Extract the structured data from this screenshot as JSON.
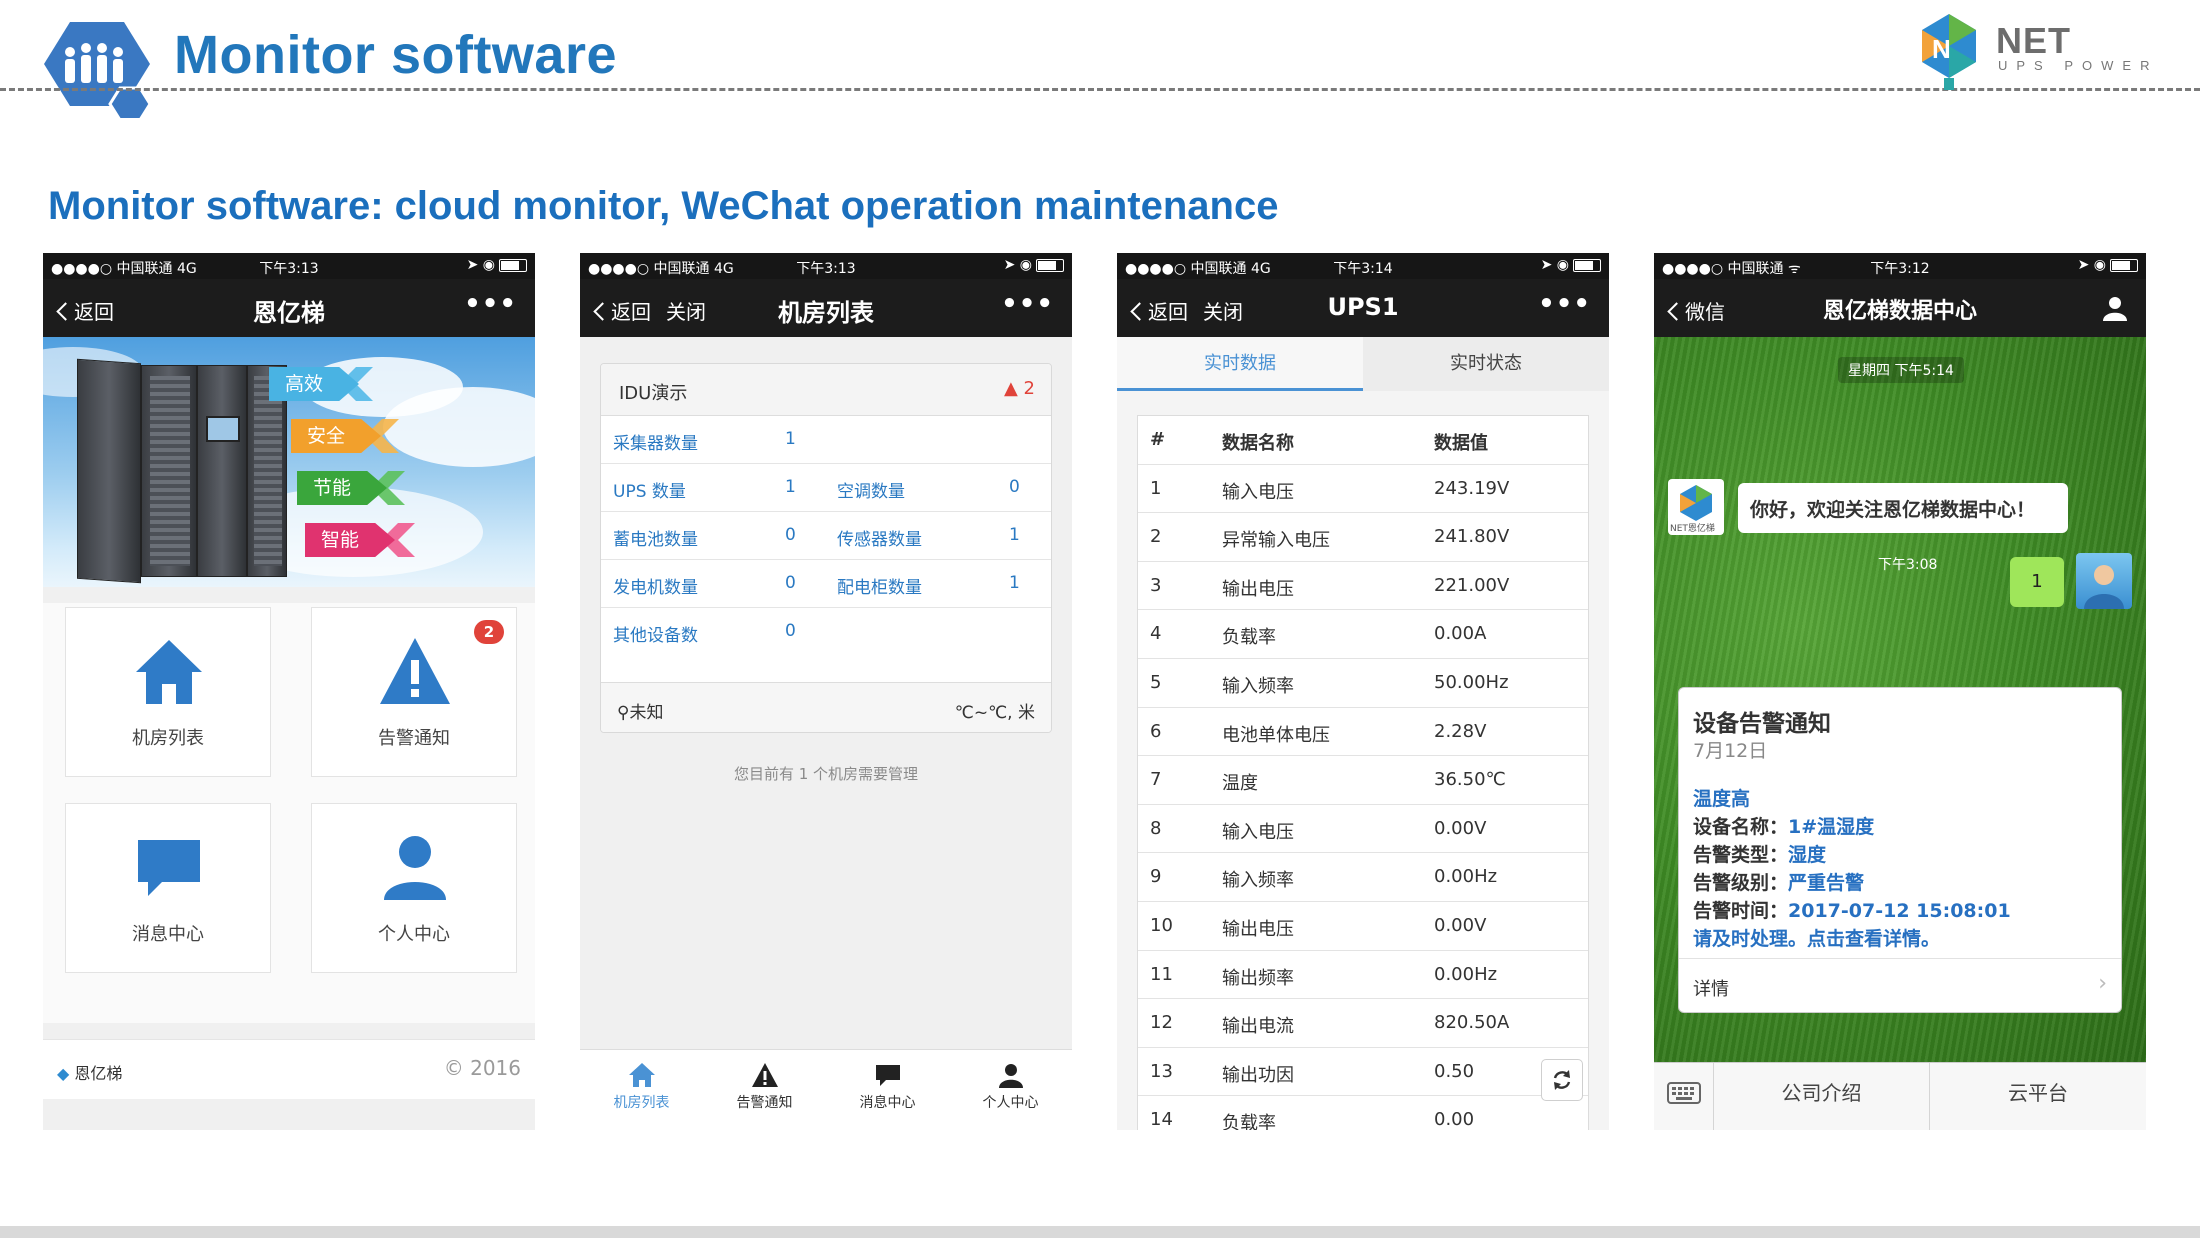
{
  "slide": {
    "title": "Monitor software",
    "subtitle": "Monitor software: cloud monitor, WeChat operation maintenance",
    "brand_name": "NET",
    "brand_sub": "UPS POWER",
    "colors": {
      "title": "#2277bb",
      "accent": "#1b6fbd"
    }
  },
  "status_bars": [
    {
      "carrier": "●●●●○ 中国联通  4G",
      "time": "下午3:13"
    },
    {
      "carrier": "●●●●○ 中国联通  4G",
      "time": "下午3:13"
    },
    {
      "carrier": "●●●●○ 中国联通  4G",
      "time": "下午3:14"
    },
    {
      "carrier": "●●●●○ 中国联通 ᯤ",
      "time": "下午3:12"
    }
  ],
  "phone1": {
    "back": "返回",
    "title": "恩亿梯",
    "more": "•••",
    "tags": [
      "高效",
      "安全",
      "节能",
      "智能"
    ],
    "tiles": [
      {
        "label": "机房列表",
        "icon": "home-icon"
      },
      {
        "label": "告警通知",
        "icon": "warning-icon",
        "badge": "2"
      },
      {
        "label": "消息中心",
        "icon": "chat-bubble-icon"
      },
      {
        "label": "个人中心",
        "icon": "user-icon"
      }
    ],
    "footer_logo": "恩亿梯",
    "copyright": "© 2016"
  },
  "phone2": {
    "back": "返回",
    "close": "关闭",
    "title": "机房列表",
    "more": "•••",
    "card_name": "IDU演示",
    "alarm_count": "2",
    "rows": [
      {
        "l1": "采集器数量",
        "v1": "1",
        "l2": "",
        "v2": ""
      },
      {
        "l1": "UPS 数量",
        "v1": "1",
        "l2": "空调数量",
        "v2": "0"
      },
      {
        "l1": "蓄电池数量",
        "v1": "0",
        "l2": "传感器数量",
        "v2": "1"
      },
      {
        "l1": "发电机数量",
        "v1": "0",
        "l2": "配电柜数量",
        "v2": "1"
      },
      {
        "l1": "其他设备数",
        "v1": "0",
        "l2": "",
        "v2": ""
      }
    ],
    "location": "未知",
    "climate": "℃~℃, 米",
    "note": "您目前有 1 个机房需要管理",
    "tabs": [
      {
        "label": "机房列表",
        "icon": "home-icon",
        "active": true
      },
      {
        "label": "告警通知",
        "icon": "warning-icon"
      },
      {
        "label": "消息中心",
        "icon": "chat-bubble-icon"
      },
      {
        "label": "个人中心",
        "icon": "user-icon"
      }
    ],
    "colors": {
      "active": "#4a92d4",
      "label": "#2a79c2"
    }
  },
  "phone3": {
    "back": "返回",
    "close": "关闭",
    "title": "UPS1",
    "more": "•••",
    "segments": [
      "实时数据",
      "实时状态"
    ],
    "columns": [
      "#",
      "数据名称",
      "数据值"
    ],
    "rows": [
      [
        "1",
        "输入电压",
        "243.19V"
      ],
      [
        "2",
        "异常输入电压",
        "241.80V"
      ],
      [
        "3",
        "输出电压",
        "221.00V"
      ],
      [
        "4",
        "负载率",
        "0.00A"
      ],
      [
        "5",
        "输入频率",
        "50.00Hz"
      ],
      [
        "6",
        "电池单体电压",
        "2.28V"
      ],
      [
        "7",
        "温度",
        "36.50℃"
      ],
      [
        "8",
        "输入电压",
        "0.00V"
      ],
      [
        "9",
        "输入频率",
        "0.00Hz"
      ],
      [
        "10",
        "输出电压",
        "0.00V"
      ],
      [
        "11",
        "输出频率",
        "0.00Hz"
      ],
      [
        "12",
        "输出电流",
        "820.50A"
      ],
      [
        "13",
        "输出功因",
        "0.50"
      ],
      [
        "14",
        "负载率",
        "0.00"
      ]
    ]
  },
  "phone4": {
    "back": "微信",
    "title": "恩亿梯数据中心",
    "time_pill_1": "星期四 下午5:14",
    "welcome": "你好，欢迎关注恩亿梯数据中心！",
    "reply": "1",
    "time_pill_2": "下午3:08",
    "avatar_caption": "NET恩亿梯",
    "notice": {
      "title": "设备告警通知",
      "date": "7月12日",
      "headline": "温度高",
      "lines": [
        {
          "k": "设备名称：",
          "v": "1#温湿度"
        },
        {
          "k": "告警类型：",
          "v": "湿度"
        },
        {
          "k": "告警级别：",
          "v": "严重告警"
        },
        {
          "k": "告警时间：",
          "v": "2017-07-12 15:08:01"
        }
      ],
      "action": "请及时处理。点击查看详情。",
      "details": "详情"
    },
    "menu": [
      "公司介绍",
      "云平台"
    ]
  }
}
